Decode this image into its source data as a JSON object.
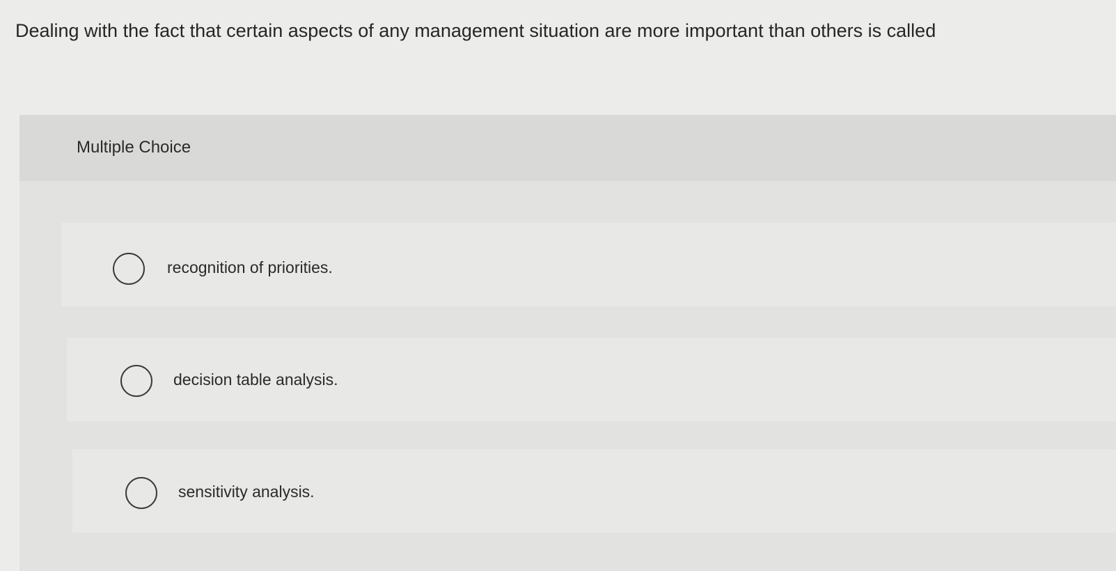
{
  "question": {
    "text": "Dealing with the fact that certain aspects of any management situation are more important than others is called"
  },
  "panel": {
    "type_label": "Multiple Choice"
  },
  "choices": [
    {
      "label": "recognition of priorities.",
      "selected": false
    },
    {
      "label": "decision table analysis.",
      "selected": false
    },
    {
      "label": "sensitivity analysis.",
      "selected": false
    }
  ],
  "colors": {
    "background": "#ececeb",
    "panel": "#e2e2e0",
    "panel_header": "#d9d9d7",
    "choice_row": "#e8e8e6",
    "text": "#262626",
    "radio_border": "#3a3a3a"
  }
}
